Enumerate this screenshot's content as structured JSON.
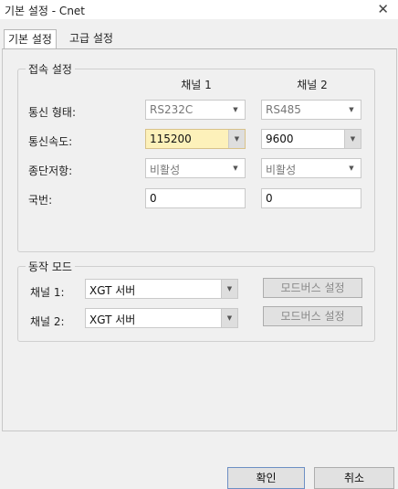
{
  "window": {
    "title": "기본 설정 - Cnet",
    "close_glyph": "✕"
  },
  "tabs": [
    {
      "label": "기본 설정",
      "active": true
    },
    {
      "label": "고급 설정",
      "active": false
    }
  ],
  "connection": {
    "title": "접속 설정",
    "columns": [
      "채널 1",
      "채널 2"
    ],
    "rows": [
      {
        "label": "통신 형태:",
        "ch1": "RS232C",
        "ch2": "RS485"
      },
      {
        "label": "통신속도:",
        "ch1": "115200",
        "ch2": "9600"
      },
      {
        "label": "종단저항:",
        "ch1": "비활성",
        "ch2": "비활성"
      },
      {
        "label": "국번:",
        "ch1": "0",
        "ch2": "0"
      }
    ]
  },
  "operation": {
    "title": "동작 모드",
    "rows": [
      {
        "label": "채널 1:",
        "mode": "XGT 서버",
        "button": "모드버스 설정"
      },
      {
        "label": "채널 2:",
        "mode": "XGT 서버",
        "button": "모드버스 설정"
      }
    ]
  },
  "footer": {
    "ok": "확인",
    "cancel": "취소"
  },
  "colors": {
    "highlight": "#fdf1ba",
    "background": "#f0f0f0"
  },
  "icons": {
    "dropdown": "chevron-down-icon",
    "close": "close-icon"
  }
}
